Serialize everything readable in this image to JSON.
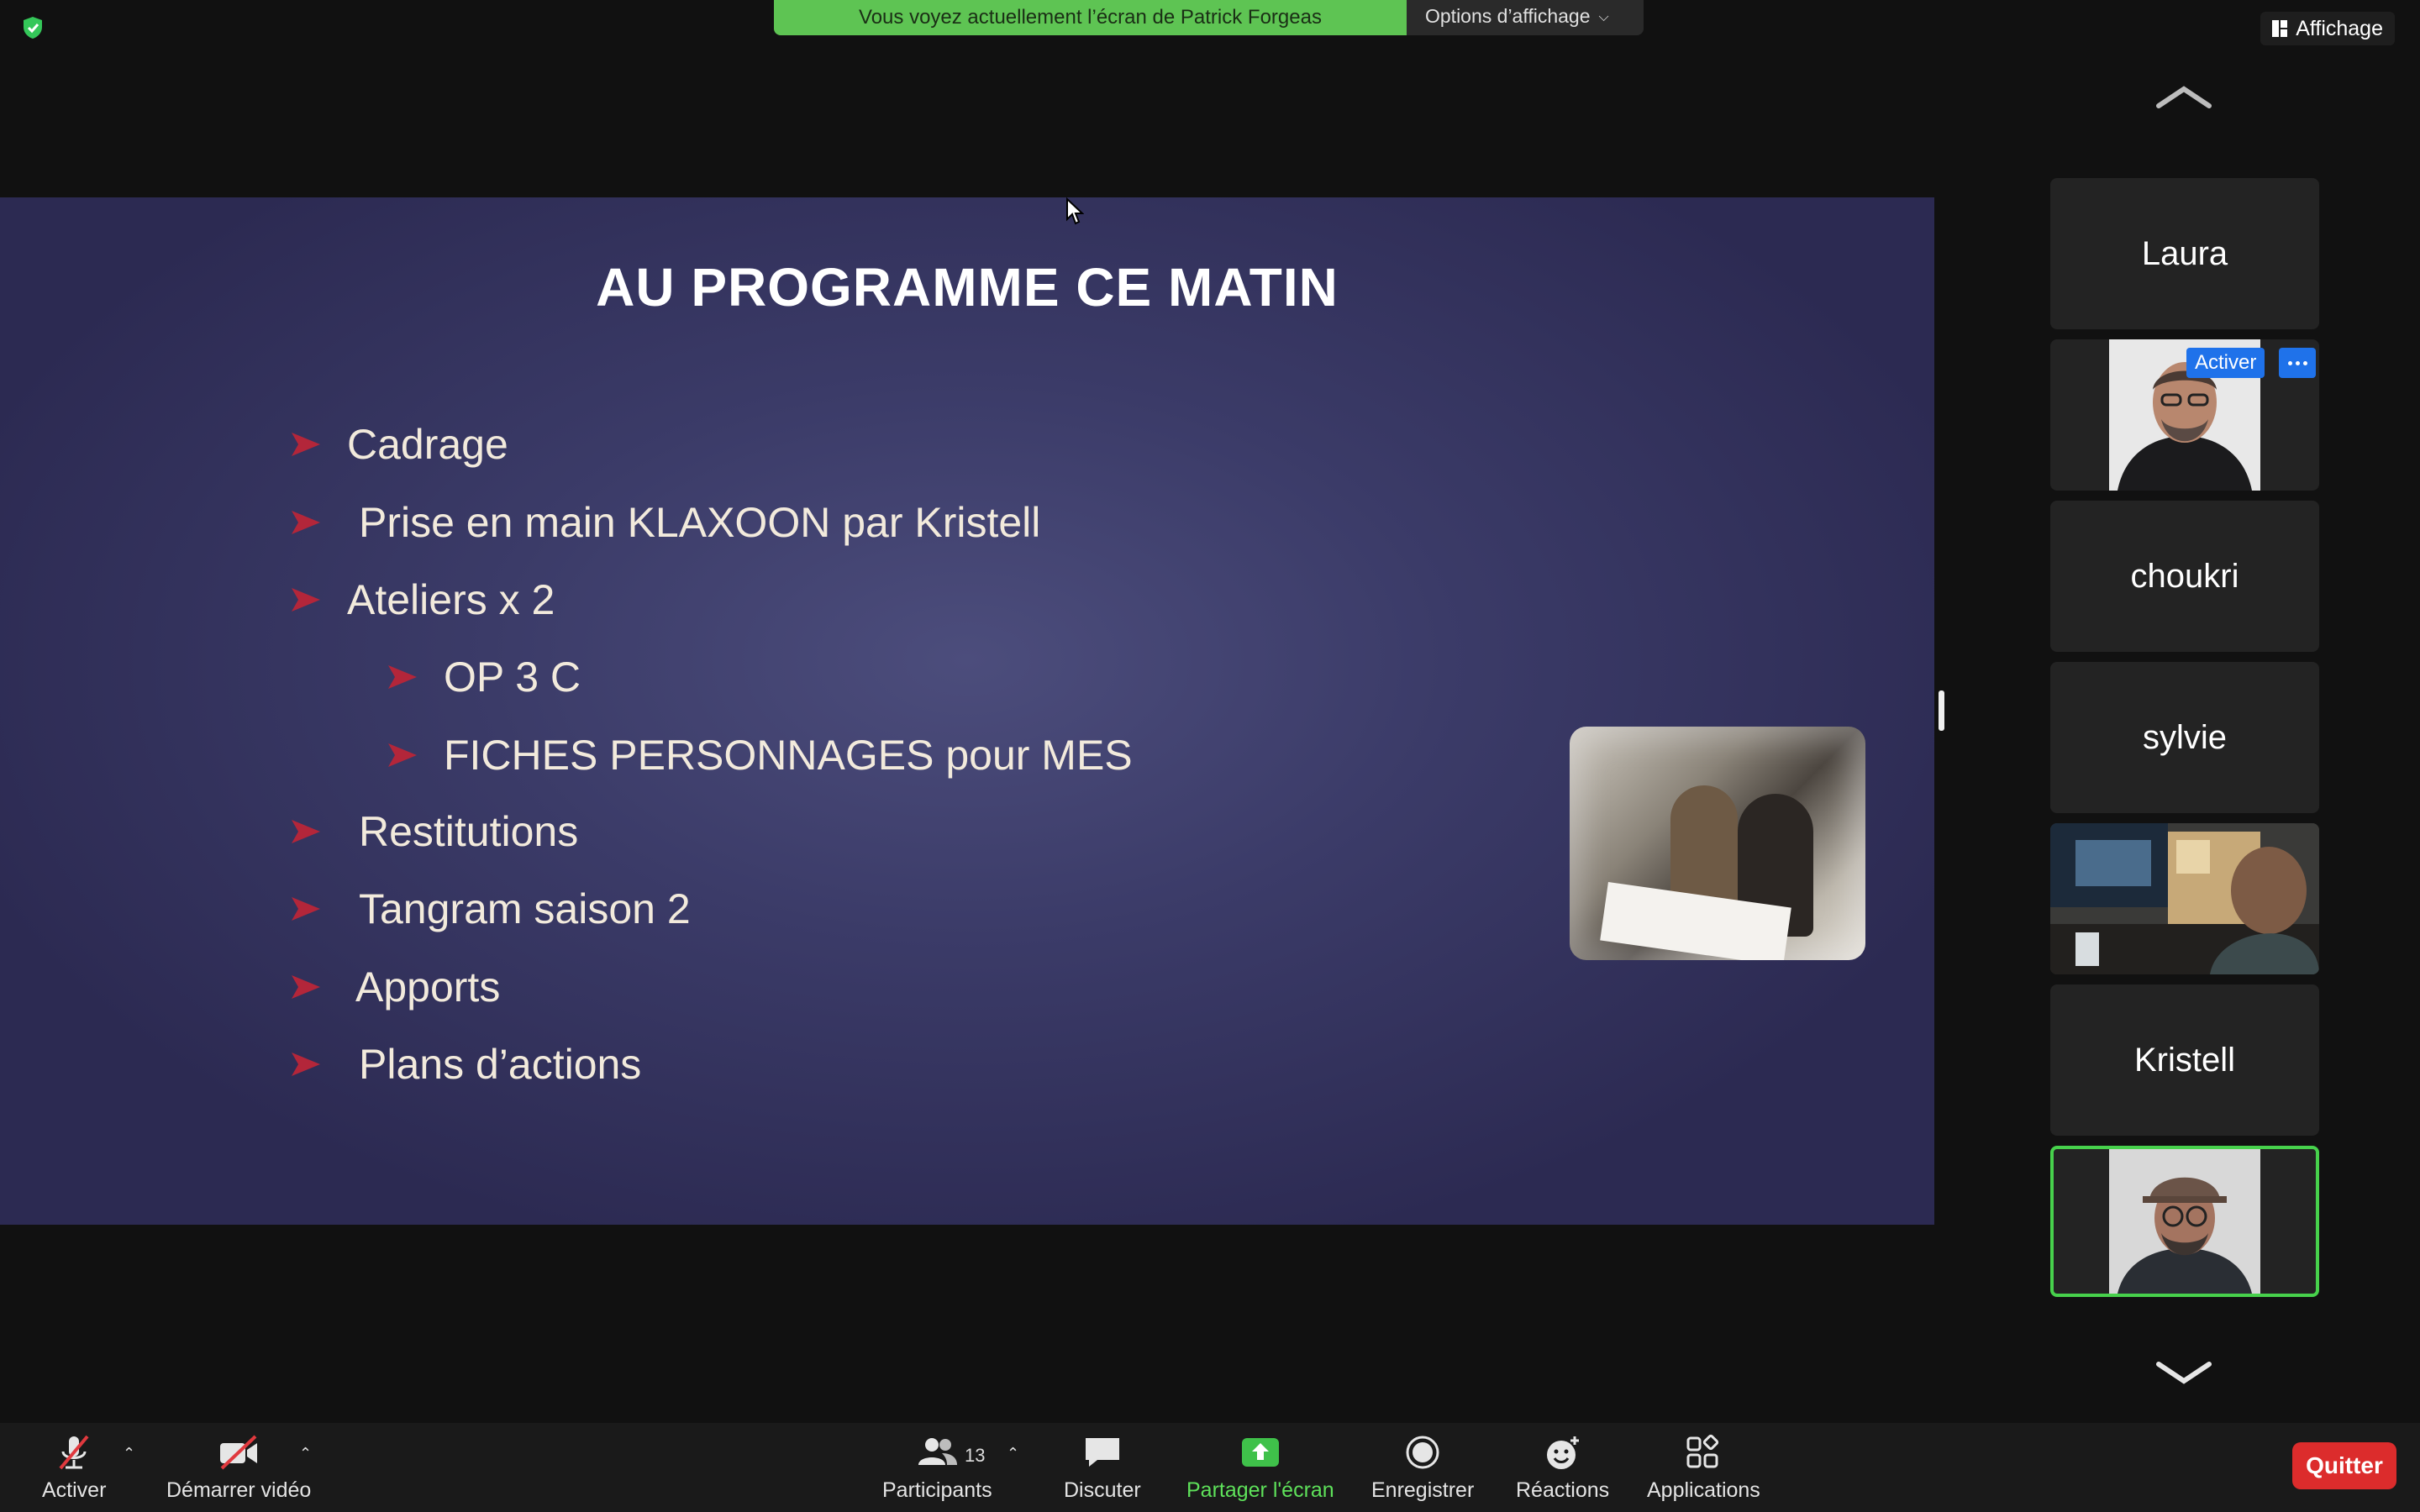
{
  "banner": {
    "sharing_text": "Vous voyez actuellement l’écran de Patrick Forgeas",
    "view_options_label": "Options d’affichage"
  },
  "top_right": {
    "view_label": "Affichage"
  },
  "slide": {
    "title": "AU PROGRAMME CE MATIN",
    "bullets": [
      "Cadrage",
      "Prise en main KLAXOON par Kristell",
      "Ateliers x 2",
      "OP 3 C",
      "FICHES PERSONNAGES pour MES",
      "Restitutions",
      "Tangram saison 2",
      "Apports",
      "Plans d’actions"
    ]
  },
  "gallery": {
    "participants": [
      {
        "name": "Laura",
        "video": false
      },
      {
        "name": "",
        "video": true,
        "hover_label": "Activer",
        "more": "···"
      },
      {
        "name": "choukri",
        "video": false
      },
      {
        "name": "sylvie",
        "video": false
      },
      {
        "name": "",
        "video": true
      },
      {
        "name": "Kristell",
        "video": false
      },
      {
        "name": "",
        "video": true,
        "active_speaker": true
      }
    ]
  },
  "toolbar": {
    "unmute_label": "Activer",
    "start_video_label": "Démarrer vidéo",
    "participants_label": "Participants",
    "participants_count": "13",
    "chat_label": "Discuter",
    "share_label": "Partager l'écran",
    "record_label": "Enregistrer",
    "reactions_label": "Réactions",
    "apps_label": "Applications",
    "quit_label": "Quitter"
  },
  "colors": {
    "share_green": "#5ec453",
    "accent_blue": "#1f72ea",
    "quit_red": "#dc2c2c",
    "slide_bg": "#3b3b68"
  }
}
